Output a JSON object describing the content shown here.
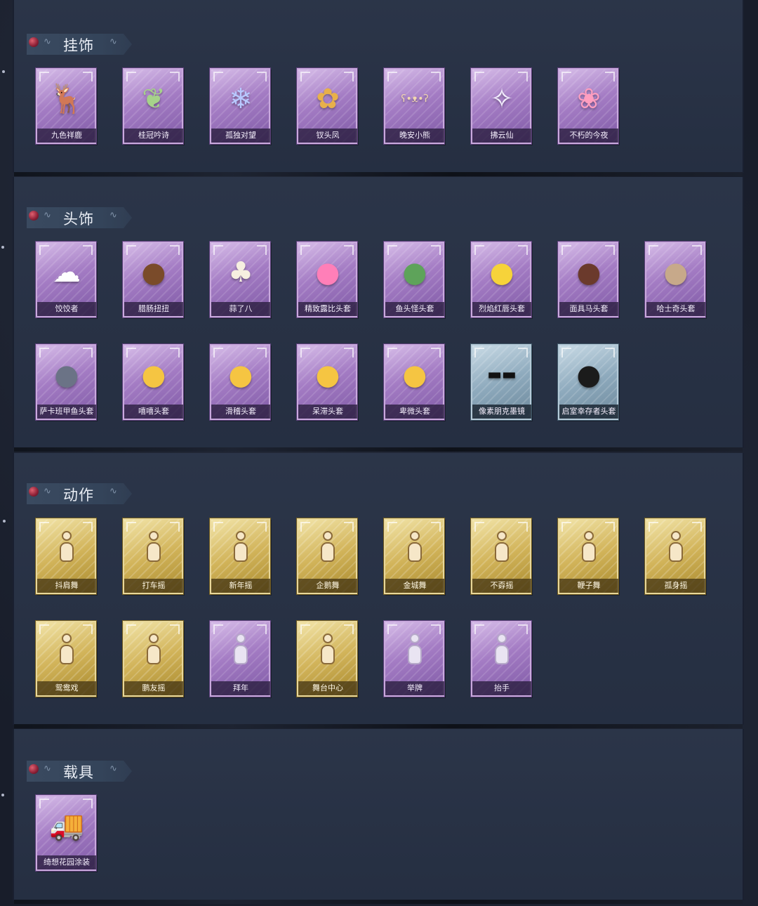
{
  "sections": [
    {
      "id": "pendants",
      "title": "挂饰",
      "items": [
        {
          "label": "九色祥鹿",
          "icon": "deer-pendant-icon",
          "rarity": "purple"
        },
        {
          "label": "桂冠吟诗",
          "icon": "laurel-pendant-icon",
          "rarity": "purple"
        },
        {
          "label": "孤独对望",
          "icon": "lonely-gaze-pendant-icon",
          "rarity": "purple"
        },
        {
          "label": "钗头凤",
          "icon": "phoenix-hairpin-pendant-icon",
          "rarity": "purple"
        },
        {
          "label": "晚安小熊",
          "icon": "bear-pendant-icon",
          "rarity": "purple"
        },
        {
          "label": "拂云仙",
          "icon": "cloud-fairy-pendant-icon",
          "rarity": "purple"
        },
        {
          "label": "不朽的今夜",
          "icon": "immortal-night-pendant-icon",
          "rarity": "purple"
        }
      ]
    },
    {
      "id": "headwear",
      "title": "头饰",
      "items": [
        {
          "label": "饺饺者",
          "icon": "dumpling-head-icon",
          "rarity": "purple"
        },
        {
          "label": "腊肠扭扭",
          "icon": "sausage-dog-head-icon",
          "rarity": "purple"
        },
        {
          "label": "蒜了八",
          "icon": "garlic-head-icon",
          "rarity": "purple"
        },
        {
          "label": "精致露比头套",
          "icon": "ruby-head-icon",
          "rarity": "purple"
        },
        {
          "label": "鱼头怪头套",
          "icon": "fish-head-icon",
          "rarity": "purple"
        },
        {
          "label": "烈焰红唇头套",
          "icon": "red-lips-head-icon",
          "rarity": "purple"
        },
        {
          "label": "面具马头套",
          "icon": "horse-head-icon",
          "rarity": "purple"
        },
        {
          "label": "哈士奇头套",
          "icon": "husky-head-icon",
          "rarity": "purple"
        },
        {
          "label": "萨卡班甲鱼头套",
          "icon": "sacabambaspis-head-icon",
          "rarity": "purple"
        },
        {
          "label": "嘻嘻头套",
          "icon": "grin-emoji-head-icon",
          "rarity": "purple"
        },
        {
          "label": "滑稽头套",
          "icon": "funny-emoji-head-icon",
          "rarity": "purple"
        },
        {
          "label": "呆滞头套",
          "icon": "dazed-emoji-head-icon",
          "rarity": "purple"
        },
        {
          "label": "卑微头套",
          "icon": "humble-emoji-head-icon",
          "rarity": "purple"
        },
        {
          "label": "像素朋克墨镜",
          "icon": "pixel-sunglasses-icon",
          "rarity": "blue"
        },
        {
          "label": "启室幸存者头套",
          "icon": "gas-mask-helmet-icon",
          "rarity": "blue"
        }
      ]
    },
    {
      "id": "actions",
      "title": "动作",
      "items": [
        {
          "label": "抖肩舞",
          "icon": "shoulder-dance-icon",
          "rarity": "gold"
        },
        {
          "label": "打车摇",
          "icon": "taxi-dance-icon",
          "rarity": "gold"
        },
        {
          "label": "新年摇",
          "icon": "new-year-dance-icon",
          "rarity": "gold"
        },
        {
          "label": "企鹅舞",
          "icon": "penguin-dance-icon",
          "rarity": "gold"
        },
        {
          "label": "金城舞",
          "icon": "golden-city-dance-icon",
          "rarity": "gold"
        },
        {
          "label": "不孬摇",
          "icon": "not-bad-dance-icon",
          "rarity": "gold"
        },
        {
          "label": "鞭子舞",
          "icon": "whip-dance-icon",
          "rarity": "gold"
        },
        {
          "label": "孤身摇",
          "icon": "solo-dance-icon",
          "rarity": "gold"
        },
        {
          "label": "鸳鸯戏",
          "icon": "mandarin-duck-dance-icon",
          "rarity": "gold"
        },
        {
          "label": "鹏友摇",
          "icon": "friend-dance-icon",
          "rarity": "gold"
        },
        {
          "label": "拜年",
          "icon": "new-year-greeting-icon",
          "rarity": "purple"
        },
        {
          "label": "舞台中心",
          "icon": "stage-center-icon",
          "rarity": "gold"
        },
        {
          "label": "举牌",
          "icon": "hold-sign-icon",
          "rarity": "purple"
        },
        {
          "label": "抬手",
          "icon": "raise-hand-icon",
          "rarity": "purple"
        }
      ]
    },
    {
      "id": "vehicles",
      "title": "载具",
      "items": [
        {
          "label": "绮想花园涂装",
          "icon": "garden-truck-icon",
          "rarity": "purple"
        }
      ]
    }
  ]
}
